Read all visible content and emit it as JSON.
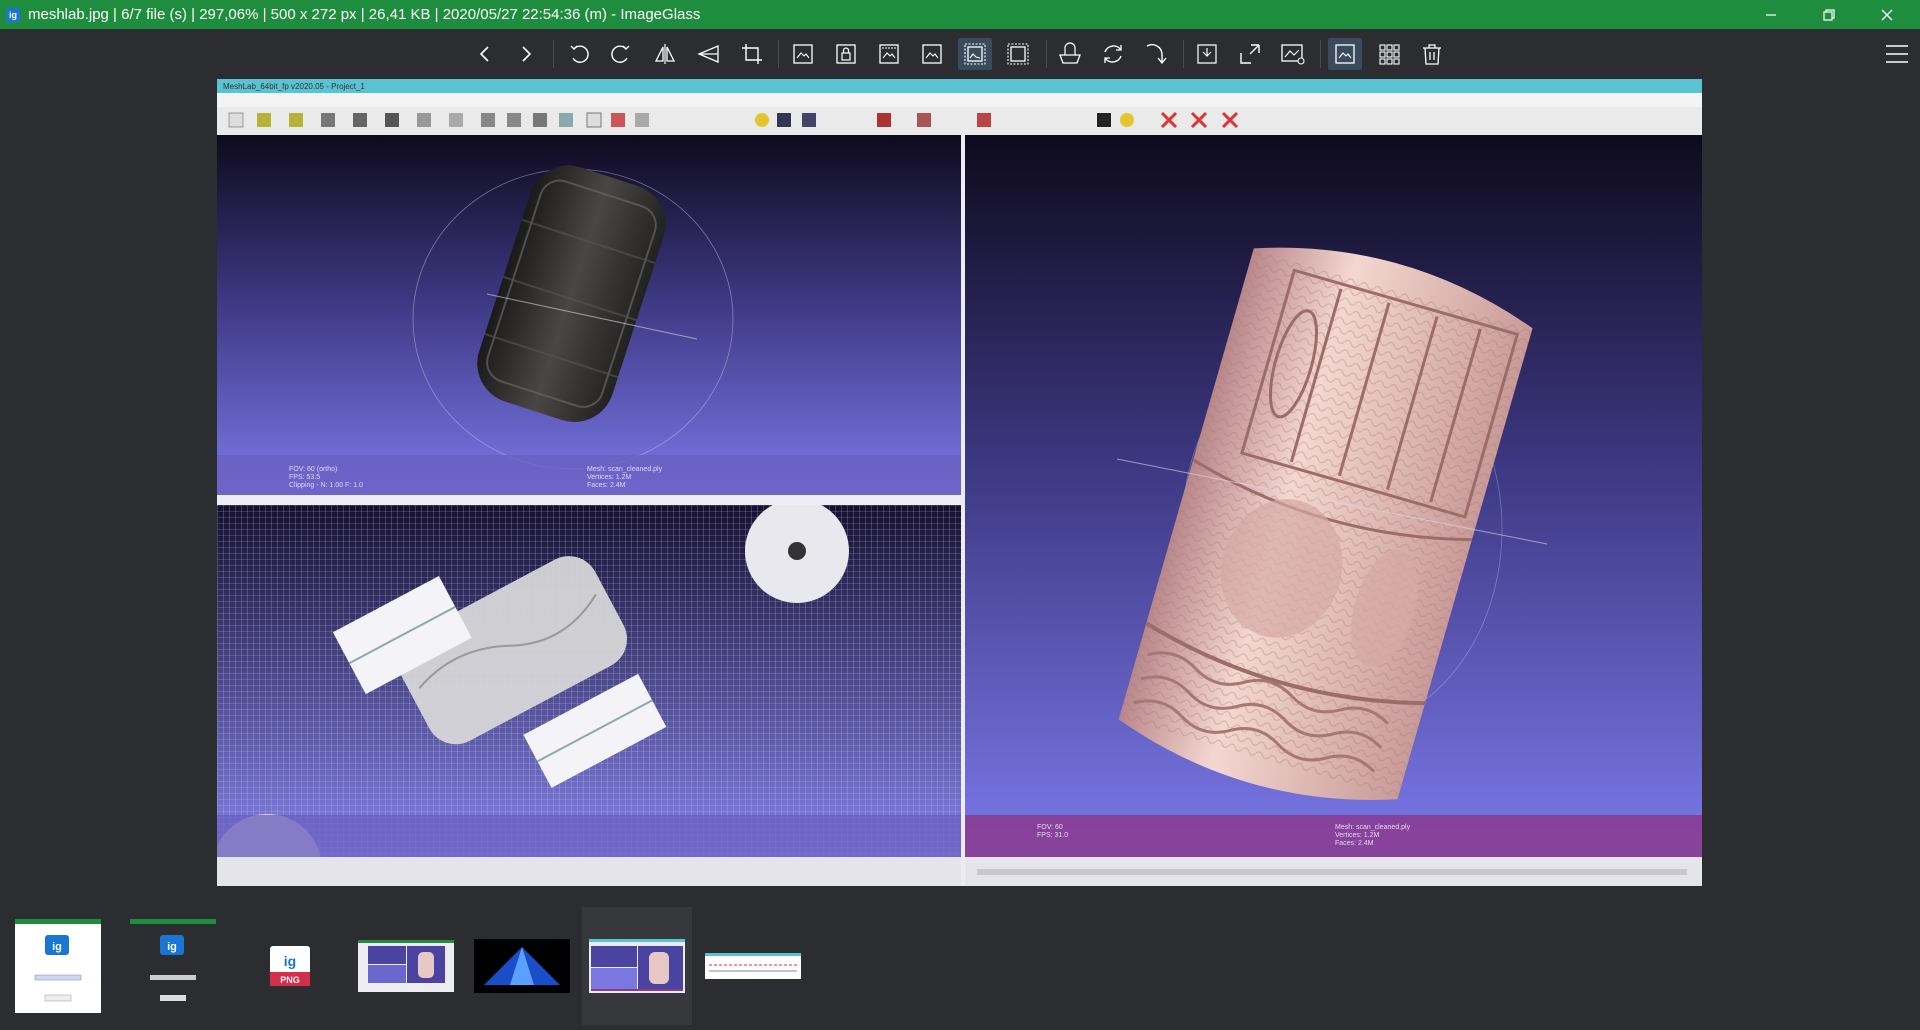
{
  "window": {
    "app_icon_label": "ig",
    "title": "meshlab.jpg  |  6/7 file (s)  |  297,06%  |  500 x 272 px  |  26,41 KB  |  2020/05/27 22:54:36 (m)  - ImageGlass",
    "buttons": [
      "minimize-icon",
      "restore-icon",
      "close-icon"
    ]
  },
  "toolbar": {
    "buttons": [
      {
        "name": "previous-image-button",
        "icon": "chevron-left-icon"
      },
      {
        "name": "next-image-button",
        "icon": "chevron-right-icon"
      },
      {
        "name": "rotate-left-button",
        "icon": "rotate-ccw-icon"
      },
      {
        "name": "rotate-right-button",
        "icon": "rotate-cw-icon"
      },
      {
        "name": "flip-horizontal-button",
        "icon": "flip-horizontal-icon"
      },
      {
        "name": "flip-vertical-button",
        "icon": "flip-vertical-icon"
      },
      {
        "name": "crop-button",
        "icon": "crop-icon"
      },
      {
        "name": "auto-zoom-button",
        "icon": "auto-zoom-icon"
      },
      {
        "name": "lock-zoom-button",
        "icon": "lock-zoom-icon"
      },
      {
        "name": "scale-to-width-button",
        "icon": "scale-width-icon"
      },
      {
        "name": "scale-to-height-button",
        "icon": "scale-height-icon"
      },
      {
        "name": "scale-to-fit-button",
        "icon": "scale-fit-icon",
        "active": true
      },
      {
        "name": "scale-to-fill-button",
        "icon": "scale-fill-icon"
      },
      {
        "name": "slideshow-button",
        "icon": "slideshow-icon"
      },
      {
        "name": "refresh-button",
        "icon": "refresh-icon"
      },
      {
        "name": "goto-image-button",
        "icon": "goto-icon"
      },
      {
        "name": "window-fit-button",
        "icon": "window-fit-icon"
      },
      {
        "name": "fullscreen-button",
        "icon": "fullscreen-icon"
      },
      {
        "name": "frameless-button",
        "icon": "frameless-icon"
      },
      {
        "name": "thumbnail-bar-button",
        "icon": "thumbnail-bar-icon",
        "active": true
      },
      {
        "name": "gallery-button",
        "icon": "grid-icon"
      },
      {
        "name": "delete-button",
        "icon": "trash-icon"
      },
      {
        "name": "main-menu-button",
        "icon": "hamburger-menu-icon"
      }
    ]
  },
  "viewer": {
    "image_window_title": "MeshLab_64bit_fp v2020.05 - Project_1",
    "viewport_tl_info": [
      "FOV: 60 (ortho)",
      "FPS:   53.5",
      "Clipping - N: 1.00  F: 1.0"
    ],
    "viewport_tl_mesh": [
      "Mesh: scan_cleaned.ply",
      "Vertices: 1.2M",
      "Faces: 2.4M"
    ],
    "viewport_r_info": [
      "FOV: 60",
      "FPS:  31.0"
    ],
    "viewport_r_mesh": [
      "Mesh: scan_cleaned.ply",
      "Vertices: 1.2M",
      "Faces: 2.4M"
    ]
  },
  "thumbnails": [
    {
      "name": "thumb-1",
      "label": "ig"
    },
    {
      "name": "thumb-2",
      "label": "ig"
    },
    {
      "name": "thumb-3",
      "label": "ig",
      "badge": "PNG"
    },
    {
      "name": "thumb-4",
      "label": ""
    },
    {
      "name": "thumb-5",
      "label": ""
    },
    {
      "name": "thumb-6",
      "label": "",
      "active": true
    },
    {
      "name": "thumb-7",
      "label": ""
    }
  ],
  "colors": {
    "titlebar": "#1e8e3e",
    "background": "#2b2d30",
    "active_button": "#3a4b5e",
    "viewport_top": "#0f0a1e",
    "viewport_bottom": "#7a78e8",
    "info_bar": "#8a3a8e"
  }
}
